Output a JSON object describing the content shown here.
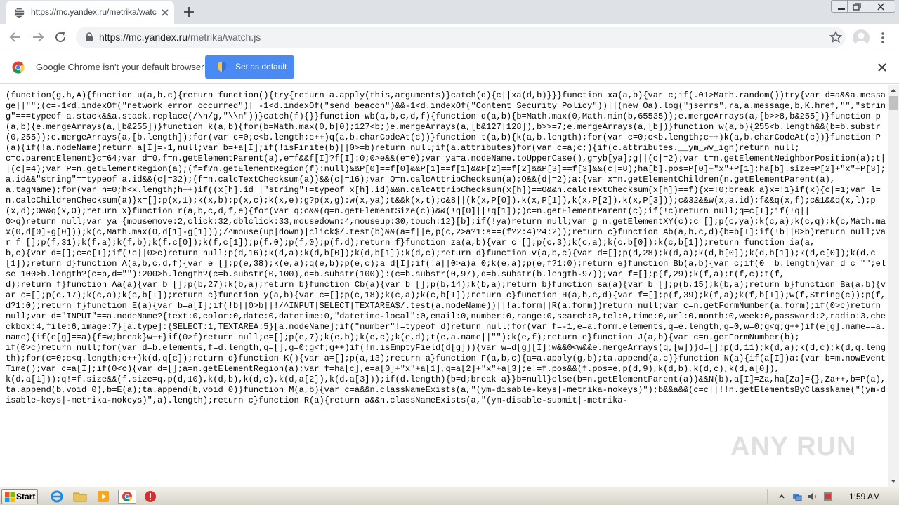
{
  "browser": {
    "tab_title": "https://mc.yandex.ru/metrika/watch",
    "url_host": "https://mc.yandex.ru",
    "url_path": "/metrika/watch.js"
  },
  "infobar": {
    "message": "Google Chrome isn't your default browser",
    "button_label": "Set as default"
  },
  "content": {
    "code": "(function(g,h,A){function u(a,b,c){return function(){try{return a.apply(this,arguments)}catch(d){c||xa(d,b)}}}function xa(a,b){var c;if(.01>Math.random())try{var d=a&&a.message||\"\";(c=-1<d.indexOf(\"network error occurred\")||-1<d.indexOf(\"send beacon\")&&-1<d.indexOf(\"Content Security Policy\"))||(new Oa).log(\"jserrs\",ra,a.message,b,K.href,\"\",\"string\"===typeof a.stack&&a.stack.replace(/\\n/g,\"\\\\n\"))}catch(f){}}function wb(a,b,c,d,f){function q(a,b){b=Math.max(0,Math.min(b,65535));e.mergeArrays(a,[b>>8,b&255])}function p(a,b){e.mergeArrays(a,[b&255])}function k(a,b){for(b=Math.max(0,b|0);127<b;)e.mergeArrays(a,[b&127|128]),b>>=7;e.mergeArrays(a,[b])}function w(a,b){255<b.length&&(b=b.substr(0,255));e.mergeArrays(a,[b.length]);for(var c=0;c<b.length;c++)q(a,b.charCodeAt(c))}function t(a,b){k(a,b.length);for(var c=0;c<b.length;c++)k(a,b.charCodeAt(c))}function P(a){if(!a.nodeName)return a[I]=-1,null;var b=+a[I];if(!isFinite(b)||0>=b)return null;if(a.attributes)for(var c=a;c;){if(c.attributes.__ym_wv_ign)return null;\nc=c.parentElement}c=64;var d=0,f=n.getElementParent(a),e=f&&f[I]?f[I]:0;0>e&&(e=0);var ya=a.nodeName.toUpperCase(),g=yb[ya];g||(c|=2);var t=n.getElementNeighborPosition(a);t||(c|=4);var P=n.getElementRegion(a);(f=f?n.getElementRegion(f):null)&&P[0]==f[0]&&P[1]==f[1]&&P[2]==f[2]&&P[3]==f[3]&&(c|=8);ha[b].pos=P[0]+\"x\"+P[1];ha[b].size=P[2]+\"x\"+P[3];a.id&&\"string\"==typeof a.id&&(c|=32);(f=n.calcTextChecksum(a))&&(c|=16);var O=n.calcAttribChecksum(a);O&&(d|=2);a:{var x=n.getElementChildren(n.getElementParent(a),\na.tagName);for(var h=0;h<x.length;h++)if((x[h].id||\"string\"!=typeof x[h].id)&&n.calcAttribChecksum(x[h])==O&&n.calcTextChecksum(x[h])==f){x=!0;break a}x=!1}if(x){c|=1;var l=n.calcChildrenChecksum(a)}x=[];p(x,1);k(x,b);p(x,c);k(x,e);g?p(x,g):w(x,ya);t&&k(x,t);c&8||(k(x,P[0]),k(x,P[1]),k(x,P[2]),k(x,P[3]));c&32&&w(x,a.id);f&&q(x,f);c&1&&q(x,l);p(x,d);O&&q(x,O);return x}function r(a,b,c,d,f,e){for(var q;c&&(q=n.getElementSize(c))&&(!q[0]||!q[1]);)c=n.getElementParent(c);if(!c)return null;q=c[I];if(!q||\n0>q)return null;var ya={mousemove:2,click:32,dblclick:33,mousedown:4,mouseup:30,touch:12}[b];if(!ya)return null;var g=n.getElementXY(c);c=[];p(c,ya);k(c,a);k(c,q);k(c,Math.max(0,d[0]-g[0]));k(c,Math.max(0,d[1]-g[1]));/^mouse(up|down)|click$/.test(b)&&(a=f||e,p(c,2>a?1:a==(f?2:4)?4:2));return c}function Ab(a,b,c,d){b=b[I];if(!b||0>b)return null;var f=[];p(f,31);k(f,a);k(f,b);k(f,c[0]);k(f,c[1]);p(f,0);p(f,0);p(f,d);return f}function za(a,b){var c=[];p(c,3);k(c,a);k(c,b[0]);k(c,b[1]);return function ia(a,\nb,c){var d=[];c=c[I];if(!c||0>c)return null;p(d,16);k(d,a);k(d,b[0]);k(d,b[1]);k(d,c);return d}function v(a,b,c){var d=[];p(d,28);k(d,a);k(d,b[0]);k(d,b[1]);k(d,c[0]);k(d,c[1]);return d}function A(a,b,c,d,f){var e=[];p(e,38);k(e,a);q(e,b);p(e,c);a=d[I];if(!a||0>a)a=0;k(e,a);p(e,f?1:0);return e}function Bb(a,b){var c;if(0==b.length)var d=c=\"\";else 100>b.length?(c=b,d=\"\"):200>b.length?(c=b.substr(0,100),d=b.substr(100)):(c=b.substr(0,97),d=b.substr(b.length-97));var f=[];p(f,29);k(f,a);t(f,c);t(f,\nd);return f}function Aa(a){var b=[];p(b,27);k(b,a);return b}function Cb(a){var b=[];p(b,14);k(b,a);return b}function sa(a){var b=[];p(b,15);k(b,a);return b}function Ba(a,b){var c=[];p(c,17);k(c,a);k(c,b[I]);return c}function y(a,b){var c=[];p(c,18);k(c,a);k(c,b[I]);return c}function H(a,b,c,d){var f=[];p(f,39);k(f,a);k(f,b[I]);w(f,String(c));p(f,d?1:0);return f}function E(a){var b=a[I];if(!b||0>b||!/^INPUT|SELECT|TEXTAREA$/.test(a.nodeName))||!a.form||R(a.form))return null;var c=n.getFormNumber(a.form);if(0>c)return null;var d=\"INPUT\"==a.nodeName?{text:0,color:0,date:0,datetime:0,\"datetime-local\":0,email:0,number:0,range:0,search:0,tel:0,time:0,url:0,month:0,week:0,password:2,radio:3,checkbox:4,file:6,image:7}[a.type]:{SELECT:1,TEXTAREA:5}[a.nodeName];if(\"number\"!=typeof d)return null;for(var f=-1,e=a.form.elements,q=e.length,g=0,w=0;g<q;g++)if(e[g].name==a.name){if(e[g]==a){f=w;break}w++}if(0>f)return null;e=[];p(e,7);k(e,b);k(e,c);k(e,d);t(e,a.name||\"\");k(e,f);return e}function J(a,b){var c=n.getFormNumber(b);\nif(0>c)return null;for(var d=b.elements,f=d.length,q=[],g=0;g<f;g++)if(!n.isEmptyField(d[g])){var w=d[g][I];w&&0<w&&e.mergeArrays(q,[w])}d=[];p(d,11);k(d,a);k(d,c);k(d,q.length);for(c=0;c<q.length;c++)k(d,q[c]);return d}function K(){var a=[];p(a,13);return a}function F(a,b,c){a=a.apply(g,b);ta.append(a,c)}function N(a){if(a[I])a:{var b=m.nowEventTime();var c=a[I];if(0<c){var d=[];a=n.getElementRegion(a);var f=ha[c],e=a[0]+\"x\"+a[1],q=a[2]+\"x\"+a[3];e!=f.pos&&(f.pos=e,p(d,9),k(d,b),k(d,c),k(d,a[0]),\nk(d,a[1]));q!=f.size&&(f.size=q,p(d,10),k(d,b),k(d,c),k(d,a[2]),k(d,a[3]));if(d.length){b=d;break a}}b=null}else(b=n.getElementParent(a))&&N(b),a[I]=Za,ha[Za]={},Za++,b=P(a),ta.append(b,void 0),b=E(a);ta.append(b,void 0)}function M(a,b){var c=a&&n.classNameExists(a,\"(ym-disable-keys|-metrika-nokeys)\");b&&a&&(c=c||!!n.getElementsByClassName(\"(ym-disable-keys|-metrika-nokeys)\",a).length);return c}function R(a){return a&&n.classNameExists(a,\"(ym-disable-submit|-metrika-"
  },
  "watermark": {
    "text": "ANY RUN"
  },
  "taskbar": {
    "start_label": "Start",
    "clock": "1:59 AM"
  },
  "colors": {
    "tabstrip": "#dee1e6",
    "accent_button": "#4a8af4",
    "taskbar": "#d6d3c9"
  }
}
